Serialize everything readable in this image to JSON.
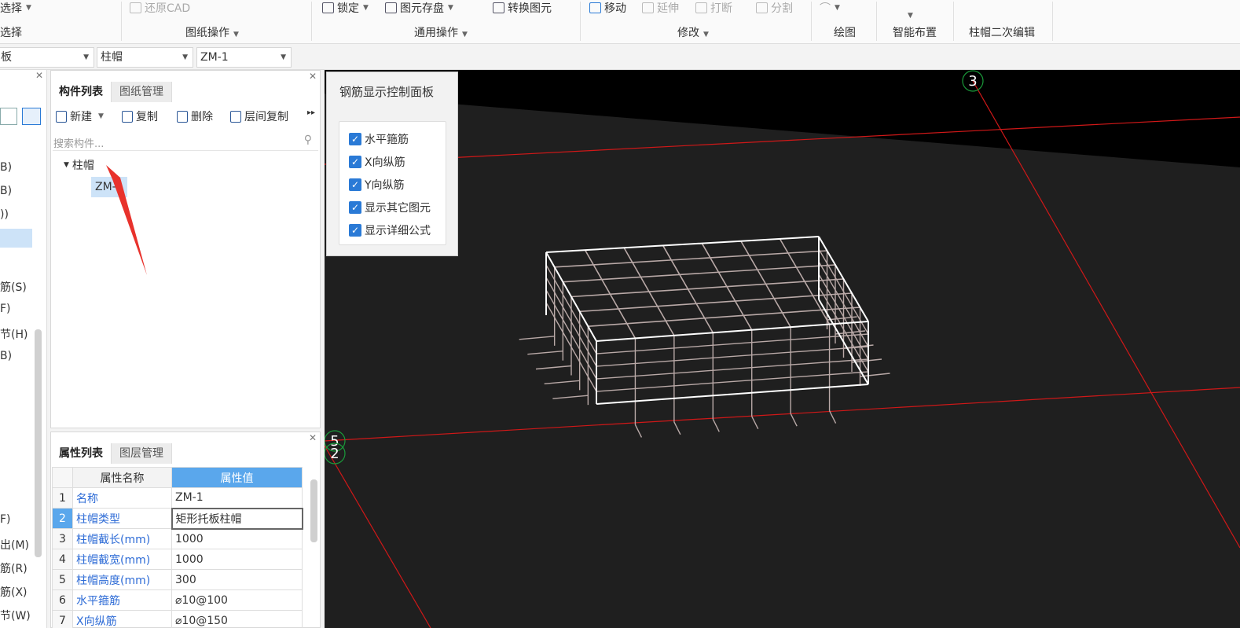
{
  "ribbon": {
    "select_top": "选择",
    "select_bottom": "选择",
    "restore_cad": "还原CAD",
    "drawing_ops": "图纸操作",
    "lock": "锁定",
    "element_save": "图元存盘",
    "convert_element": "转换图元",
    "general_ops": "通用操作",
    "move": "移动",
    "extend": "延伸",
    "break": "打断",
    "split": "分割",
    "modify": "修改",
    "draw": "绘图",
    "smart_layout": "智能布置",
    "secondary_edit": "柱帽二次编辑"
  },
  "selectors": {
    "floor_type": "板",
    "component_type": "柱帽",
    "component": "ZM-1"
  },
  "left_panel": {
    "items": [
      "B)",
      "B)",
      "))",
      "筋(S)",
      "F)",
      "节(H)",
      "B)",
      "F)",
      "出(M)",
      "筋(R)",
      "筋(X)",
      "节(W)"
    ]
  },
  "component_panel": {
    "tabs": [
      "构件列表",
      "图纸管理"
    ],
    "toolbar": {
      "new": "新建",
      "copy": "复制",
      "delete": "删除",
      "floor_copy": "层间复制"
    },
    "search_placeholder": "搜索构件...",
    "tree_root": "柱帽",
    "tree_child": "ZM-1"
  },
  "props_panel": {
    "tabs": [
      "属性列表",
      "图层管理"
    ],
    "header": {
      "name": "属性名称",
      "value": "属性值"
    },
    "rows": [
      {
        "n": "1",
        "k": "名称",
        "v": "ZM-1"
      },
      {
        "n": "2",
        "k": "柱帽类型",
        "v": "矩形托板柱帽"
      },
      {
        "n": "3",
        "k": "柱帽截长(mm)",
        "v": "1000"
      },
      {
        "n": "4",
        "k": "柱帽截宽(mm)",
        "v": "1000"
      },
      {
        "n": "5",
        "k": "柱帽高度(mm)",
        "v": "300"
      },
      {
        "n": "6",
        "k": "水平箍筋",
        "v": "⌀10@100"
      },
      {
        "n": "7",
        "k": "X向纵筋",
        "v": "⌀10@150"
      }
    ]
  },
  "rebar_panel": {
    "title": "钢筋显示控制面板",
    "options": [
      "水平箍筋",
      "X向纵筋",
      "Y向纵筋",
      "显示其它图元",
      "显示详细公式"
    ]
  },
  "viewport": {
    "axis_labels": [
      "3",
      "5",
      "2"
    ]
  },
  "colors": {
    "accent": "#2a7ad6",
    "header_blue": "#5aa7ec",
    "axis_red": "#d01818",
    "rebar": "#b9a9a7",
    "viewport_bg": "#1f1f1f"
  }
}
